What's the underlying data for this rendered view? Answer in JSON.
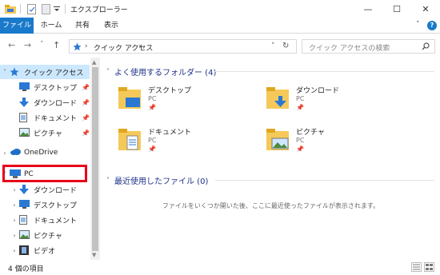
{
  "window": {
    "title": "エクスプローラー",
    "minimize_glyph": "—",
    "maximize_glyph": "☐",
    "close_glyph": "✕"
  },
  "ribbon": {
    "tabs": [
      "ファイル",
      "ホーム",
      "共有",
      "表示"
    ],
    "collapse_glyph": "˅",
    "help_glyph": "?"
  },
  "nav": {
    "back_glyph": "←",
    "forward_glyph": "→",
    "history_glyph": "˅",
    "up_glyph": "↑",
    "address_text": "クイック アクセス",
    "address_sep": "›",
    "address_dropdown": "˅",
    "refresh_glyph": "↻",
    "search_placeholder": "クイック アクセスの検索"
  },
  "sidebar": {
    "items": [
      {
        "label": "クイック アクセス",
        "icon": "star-icon",
        "expanded": true,
        "selected": true
      },
      {
        "label": "デスクトップ",
        "icon": "desktop-icon",
        "pinned": true
      },
      {
        "label": "ダウンロード",
        "icon": "download-icon",
        "pinned": true
      },
      {
        "label": "ドキュメント",
        "icon": "document-icon",
        "pinned": true
      },
      {
        "label": "ピクチャ",
        "icon": "picture-icon",
        "pinned": true
      },
      {
        "label": "OneDrive",
        "icon": "cloud-icon"
      },
      {
        "label": "PC",
        "icon": "pc-icon",
        "expanded": true
      },
      {
        "label": "ダウンロード",
        "icon": "download-icon"
      },
      {
        "label": "デスクトップ",
        "icon": "desktop-icon"
      },
      {
        "label": "ドキュメント",
        "icon": "document-icon"
      },
      {
        "label": "ピクチャ",
        "icon": "picture-icon"
      },
      {
        "label": "ビデオ",
        "icon": "video-icon"
      }
    ]
  },
  "content": {
    "frequent_header": "よく使用するフォルダー (4)",
    "recent_header": "最近使用したファイル (0)",
    "folders": [
      {
        "name": "デスクトップ",
        "location": "PC",
        "icon": "desktop-folder-icon"
      },
      {
        "name": "ダウンロード",
        "location": "PC",
        "icon": "download-folder-icon"
      },
      {
        "name": "ドキュメント",
        "location": "PC",
        "icon": "document-folder-icon"
      },
      {
        "name": "ピクチャ",
        "location": "PC",
        "icon": "picture-folder-icon"
      }
    ],
    "empty_message": "ファイルをいくつか開いた後、ここに最近使ったファイルが表示されます。"
  },
  "status": {
    "item_count": "4 個の項目"
  },
  "colors": {
    "accent": "#1979ca",
    "folder": "#f5c959",
    "selection": "#cce8ff",
    "highlight_box": "#e6001a"
  }
}
